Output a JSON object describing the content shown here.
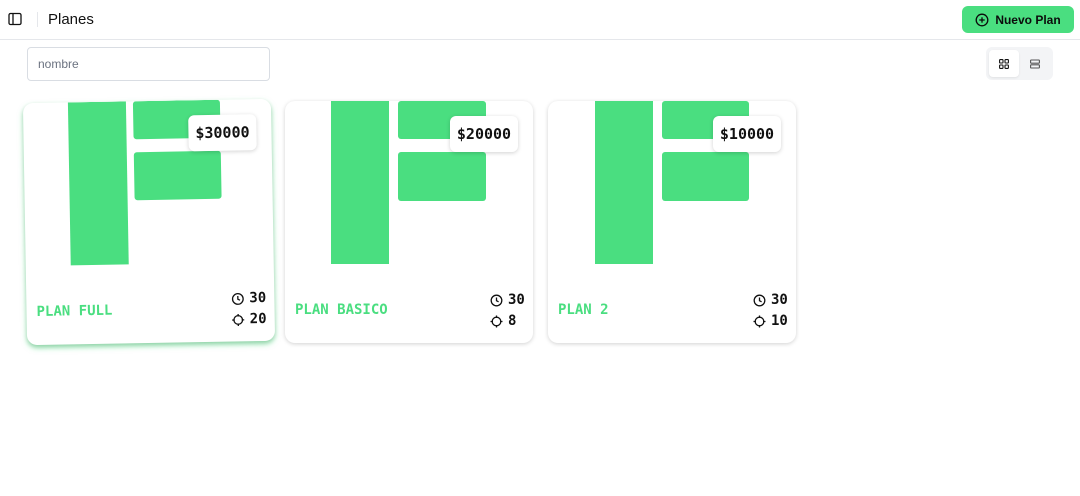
{
  "header": {
    "title": "Planes",
    "new_plan_label": "Nuevo Plan"
  },
  "search": {
    "placeholder": "nombre",
    "value": ""
  },
  "view_toggle": {
    "options": [
      "grid",
      "list"
    ],
    "selected": "grid"
  },
  "accent_color": "#4ade80",
  "plans": [
    {
      "name": "PLAN FULL",
      "price": "$30000",
      "duration": "30",
      "sessions": "20"
    },
    {
      "name": "PLAN BASICO",
      "price": "$20000",
      "duration": "30",
      "sessions": "8"
    },
    {
      "name": "PLAN 2",
      "price": "$10000",
      "duration": "30",
      "sessions": "10"
    }
  ],
  "icons": {
    "sidebar": "sidebar-icon",
    "add": "plus-circle-icon",
    "grid": "grid-icon",
    "list": "list-icon",
    "duration": "clock-icon",
    "sessions": "crosshair-icon"
  }
}
